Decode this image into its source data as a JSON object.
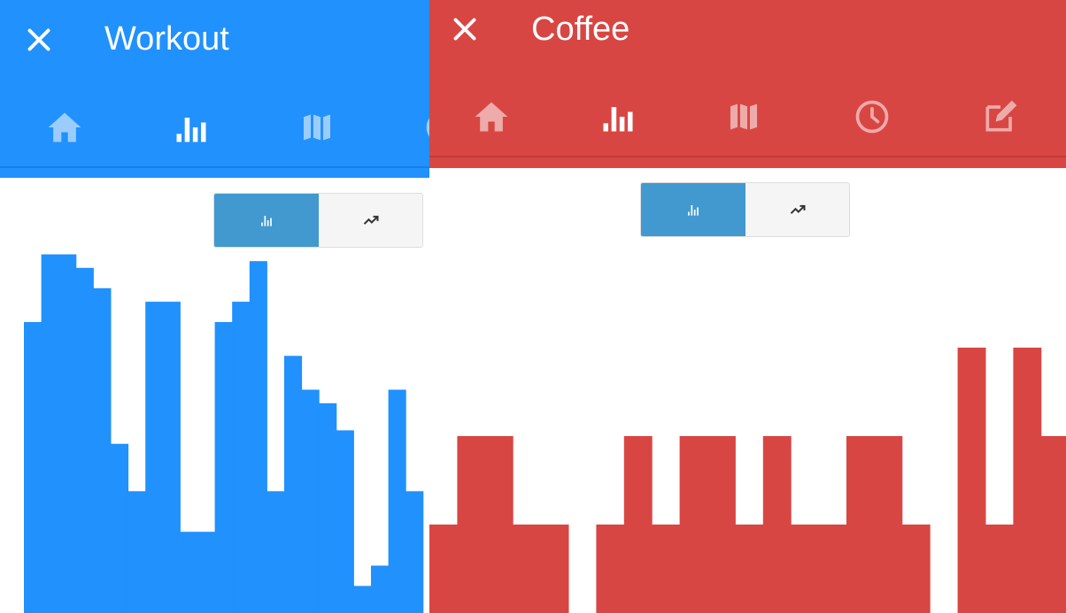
{
  "workout": {
    "title": "Workout",
    "color": "#2091fd",
    "tabs": [
      "home-icon",
      "bar-chart-icon",
      "map-icon",
      "history-icon"
    ],
    "chart_data": {
      "type": "bar",
      "values": [
        4.3,
        5.3,
        5.3,
        5.1,
        4.8,
        2.5,
        1.8,
        4.6,
        4.6,
        1.2,
        1.2,
        4.3,
        4.6,
        5.2,
        1.8,
        3.8,
        3.3,
        3.1,
        2.7,
        0.4,
        0.7,
        3.3,
        1.8
      ]
    },
    "view_toggle": [
      "bar-chart-icon",
      "trending-up-icon"
    ]
  },
  "coffee": {
    "title": "Coffee",
    "color": "#d84643",
    "tabs": [
      "home-icon",
      "bar-chart-icon",
      "map-icon",
      "history-icon",
      "edit-icon"
    ],
    "chart_data": {
      "type": "bar",
      "values": [
        1,
        2,
        2,
        1,
        1,
        0,
        1,
        2,
        1,
        2,
        2,
        1,
        2,
        1,
        1,
        2,
        2,
        1,
        0,
        3,
        1,
        3,
        2
      ]
    },
    "view_toggle": [
      "bar-chart-icon",
      "trending-up-icon"
    ]
  }
}
